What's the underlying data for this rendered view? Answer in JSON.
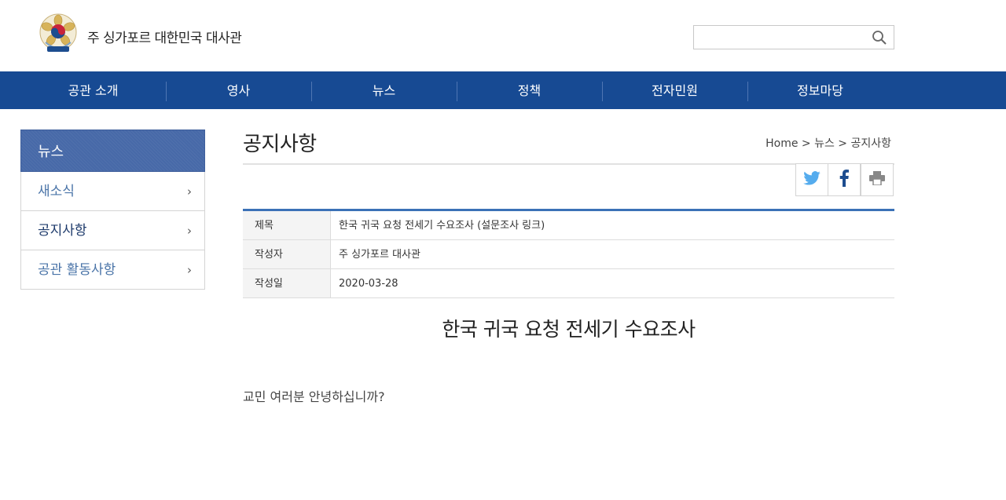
{
  "header": {
    "site_title": "주 싱가포르 대한민국 대사관",
    "search_placeholder": ""
  },
  "nav": {
    "items": [
      {
        "label": "공관 소개"
      },
      {
        "label": "영사"
      },
      {
        "label": "뉴스"
      },
      {
        "label": "정책"
      },
      {
        "label": "전자민원"
      },
      {
        "label": "정보마당"
      }
    ]
  },
  "sidebar": {
    "heading": "뉴스",
    "items": [
      {
        "label": "새소식"
      },
      {
        "label": "공지사항"
      },
      {
        "label": "공관 활동사항"
      }
    ],
    "chevron": "›"
  },
  "main": {
    "page_title": "공지사항",
    "breadcrumb": "Home > 뉴스 > 공지사항",
    "share": [
      "twitter-icon",
      "facebook-icon",
      "print-icon"
    ],
    "info": [
      {
        "label": "제목",
        "value": "한국 귀국 요청 전세기 수요조사 (설문조사 링크)"
      },
      {
        "label": "작성자",
        "value": "주 싱가포르 대사관"
      },
      {
        "label": "작성일",
        "value": "2020-03-28"
      }
    ],
    "article_heading": "한국 귀국 요청 전세기 수요조사",
    "article_body": "교민 여러분 안녕하십니까?"
  },
  "colors": {
    "nav_bg": "#174a93",
    "sidebar_head_bg": "#4769a8",
    "table_top_border": "#3b71b7",
    "twitter": "#55acee",
    "facebook": "#1d4d8f"
  }
}
